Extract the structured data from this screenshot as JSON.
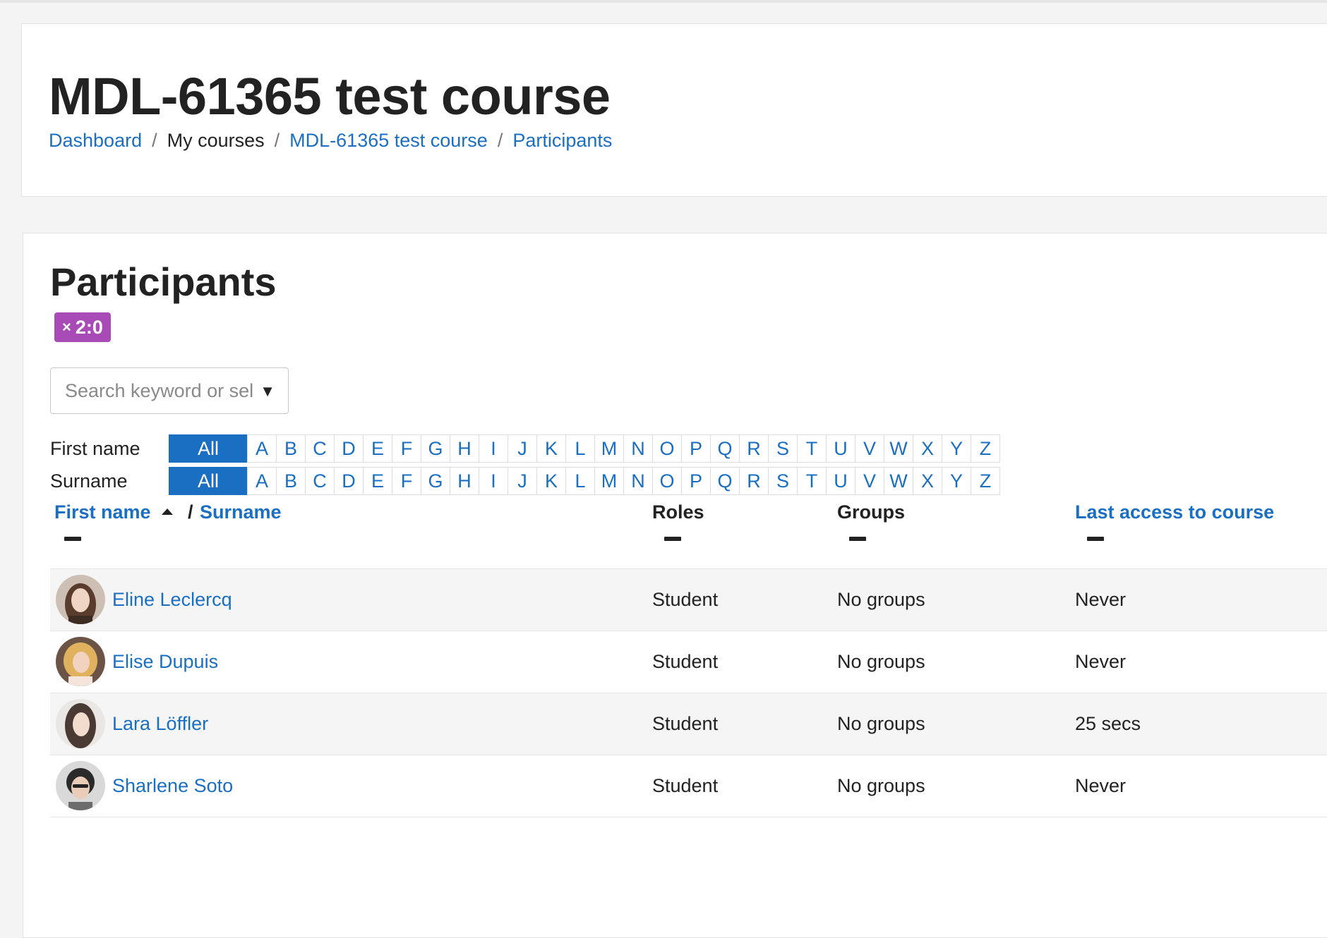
{
  "course": {
    "title": "MDL-61365 test course"
  },
  "breadcrumb": [
    {
      "label": "Dashboard",
      "link": true
    },
    {
      "label": "My courses",
      "link": false
    },
    {
      "label": "MDL-61365 test course",
      "link": true
    },
    {
      "label": "Participants",
      "link": true
    }
  ],
  "page": {
    "title": "Participants",
    "badge": {
      "close": "×",
      "label": "2:0"
    },
    "search": {
      "placeholder": "Search keyword or sel"
    }
  },
  "initials": {
    "first_name_label": "First name",
    "surname_label": "Surname",
    "all_label": "All",
    "letters": [
      "A",
      "B",
      "C",
      "D",
      "E",
      "F",
      "G",
      "H",
      "I",
      "J",
      "K",
      "L",
      "M",
      "N",
      "O",
      "P",
      "Q",
      "R",
      "S",
      "T",
      "U",
      "V",
      "W",
      "X",
      "Y",
      "Z"
    ]
  },
  "table": {
    "headers": {
      "first_name": "First name",
      "sep": "/",
      "surname": "Surname",
      "roles": "Roles",
      "groups": "Groups",
      "last_access": "Last access to course"
    },
    "rows": [
      {
        "name": "Eline Leclercq",
        "role": "Student",
        "groups": "No groups",
        "last_access": "Never",
        "avatar": "avatar-1"
      },
      {
        "name": "Elise Dupuis",
        "role": "Student",
        "groups": "No groups",
        "last_access": "Never",
        "avatar": "avatar-2"
      },
      {
        "name": "Lara Löffler",
        "role": "Student",
        "groups": "No groups",
        "last_access": "25 secs",
        "avatar": "avatar-3"
      },
      {
        "name": "Sharlene Soto",
        "role": "Student",
        "groups": "No groups",
        "last_access": "Never",
        "avatar": "avatar-4"
      }
    ]
  },
  "colors": {
    "link": "#1a6fc2",
    "badge": "#a94bb6"
  }
}
